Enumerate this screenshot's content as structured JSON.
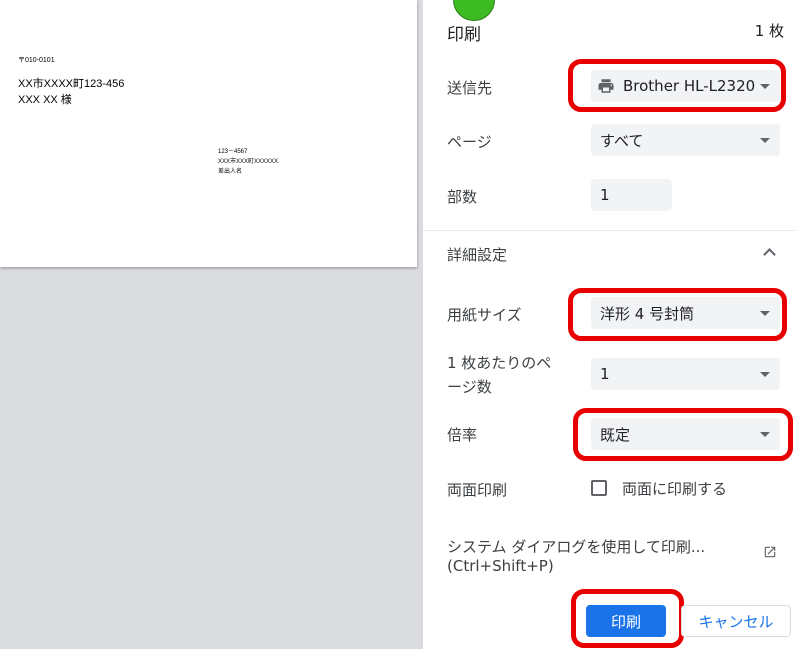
{
  "preview": {
    "postal_code": "〒010-0101",
    "recipient_address": "XX市XXXX町123-456",
    "recipient_name": "XXX XX 様",
    "sender_postal": "123－4567",
    "sender_address": "XXX市XXX町XXXXXX",
    "sender_name": "差出人名"
  },
  "header": {
    "title": "印刷",
    "sheet_count": "1 枚"
  },
  "settings": {
    "destination": {
      "label": "送信先",
      "value": "Brother HL-L2320",
      "icon": "printer-icon"
    },
    "pages": {
      "label": "ページ",
      "value": "すべて"
    },
    "copies": {
      "label": "部数",
      "value": "1"
    },
    "more_settings": {
      "label": "詳細設定",
      "icon": "chevron-up-icon"
    },
    "paper_size": {
      "label": "用紙サイズ",
      "value": "洋形 4 号封筒"
    },
    "pages_per_sheet": {
      "label_line1": "1 枚あたりのペ",
      "label_line2": "ージ数",
      "value": "1"
    },
    "scale": {
      "label": "倍率",
      "value": "既定"
    },
    "duplex": {
      "label": "両面印刷",
      "checkbox_label": "両面に印刷する",
      "checked": false
    },
    "system_dialog": {
      "line1": "システム ダイアログを使用して印刷...",
      "line2": "(Ctrl+Shift+P)",
      "icon": "open-in-new-icon"
    }
  },
  "buttons": {
    "print": "印刷",
    "cancel": "キャンセル"
  },
  "colors": {
    "accent": "#1a73e8",
    "highlight": "#e80000",
    "marker": "#3dbb23"
  }
}
